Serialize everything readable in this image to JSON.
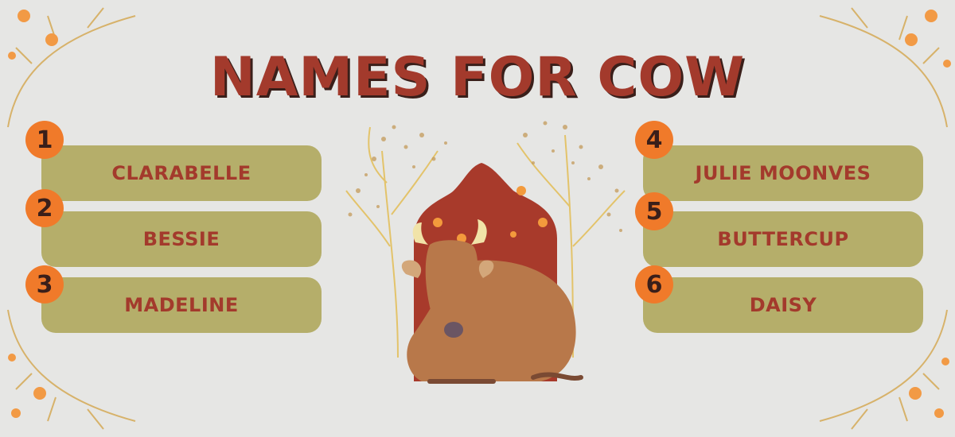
{
  "title": "NAMES FOR COW",
  "colors": {
    "background": "#e6e6e4",
    "title": "#a33a2c",
    "card": "#b5ae6a",
    "card_text": "#a33a2c",
    "badge": "#f07a2a",
    "badge_text": "#3a1f1a",
    "arch": "#a83a2b",
    "cow": "#b8784a"
  },
  "names": [
    {
      "number": "1",
      "name": "CLARABELLE"
    },
    {
      "number": "2",
      "name": "BESSIE"
    },
    {
      "number": "3",
      "name": "MADELINE"
    },
    {
      "number": "4",
      "name": "JULIE MOONVES"
    },
    {
      "number": "5",
      "name": "BUTTERCUP"
    },
    {
      "number": "6",
      "name": "DAISY"
    }
  ],
  "illustration": {
    "icon": "cow-icon",
    "backdrop": "arch-with-trees"
  },
  "decorations": {
    "icon": "flower-branch-icon"
  }
}
